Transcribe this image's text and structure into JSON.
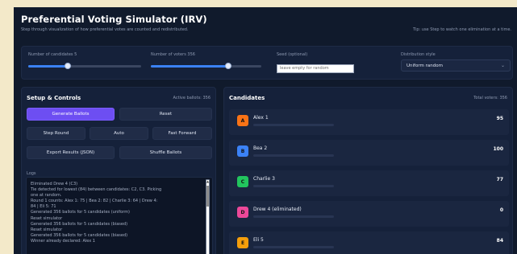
{
  "header": {
    "title": "Preferential Voting Simulator (IRV)",
    "subtitle": "Step through visualization of how preferential votes are counted and redistributed.",
    "tip": "Tip: use Step to watch one elimination at a time."
  },
  "config": {
    "candidates_label": "Number of candidates 5",
    "candidates_level": 0.35,
    "voters_label": "Number of voters 356",
    "voters_level": 0.7,
    "seed_label": "Seed (optional)",
    "seed_placeholder": "leave empty for random",
    "distribution_label": "Distribution style",
    "distribution_value": "Uniform random"
  },
  "setup": {
    "title": "Setup & Controls",
    "meta": "Active ballots: 356",
    "buttons": {
      "generate": "Generate Ballots",
      "reset": "Reset",
      "step": "Step Round",
      "auto": "Auto",
      "fast": "Fast Forward",
      "export": "Export Results (JSON)",
      "shuffle": "Shuffle Ballots"
    },
    "logs_label": "Logs",
    "logs": [
      "Eliminated Drew 4 (C3)",
      "Tie detected for lowest (84) between candidates: C2, C3. Picking",
      "one at random.",
      "Round 1 counts: Alex 1: 75 | Bea 2: 82 | Charlie 3: 64 | Drew 4:",
      "84 | Eli 5: 71",
      "Generated 356 ballots for 5 candidates (uniform)",
      "Reset simulator",
      "Generated 356 ballots for 5 candidates (biased)",
      "Reset simulator",
      "Generated 356 ballots for 5 candidates (biased)",
      "Winner already declared: Alex 1"
    ]
  },
  "candidates": {
    "title": "Candidates",
    "meta": "Total voters: 356",
    "items": [
      {
        "badge": "A",
        "name": "Alex 1",
        "votes": "95",
        "color": "#f97316"
      },
      {
        "badge": "B",
        "name": "Bea 2",
        "votes": "100",
        "color": "#3b82f6"
      },
      {
        "badge": "C",
        "name": "Charlie 3",
        "votes": "77",
        "color": "#22c55e"
      },
      {
        "badge": "D",
        "name": "Drew 4 (eliminated)",
        "votes": "0",
        "color": "#ec4899"
      },
      {
        "badge": "E",
        "name": "Eli 5",
        "votes": "84",
        "color": "#f59e0b"
      }
    ]
  },
  "colors": {
    "background": "#101a2c",
    "panel": "#15213a",
    "accent": "#3b82f6",
    "primary_button": "#6d4ef2"
  }
}
